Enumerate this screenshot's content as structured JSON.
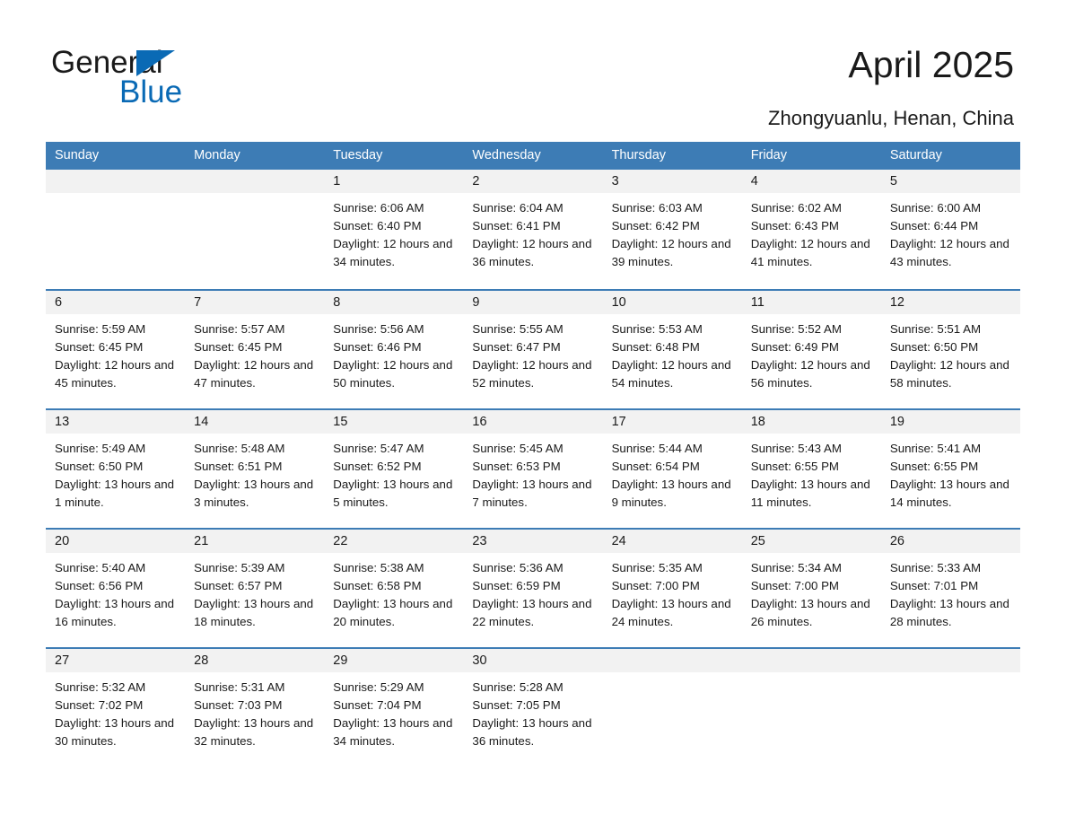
{
  "brand": {
    "name_part1": "General",
    "name_part2": "Blue",
    "triangle_color": "#0a6ab5"
  },
  "header": {
    "title": "April 2025",
    "subtitle": "Zhongyuanlu, Henan, China"
  },
  "theme": {
    "header_blue": "#3d7cb5",
    "day_band_gray": "#f2f2f2",
    "text": "#1a1a1a"
  },
  "calendar": {
    "weekdays": [
      "Sunday",
      "Monday",
      "Tuesday",
      "Wednesday",
      "Thursday",
      "Friday",
      "Saturday"
    ],
    "weeks": [
      [
        {
          "day": "",
          "sunrise": "",
          "sunset": "",
          "daylight": ""
        },
        {
          "day": "",
          "sunrise": "",
          "sunset": "",
          "daylight": ""
        },
        {
          "day": "1",
          "sunrise": "Sunrise: 6:06 AM",
          "sunset": "Sunset: 6:40 PM",
          "daylight": "Daylight: 12 hours and 34 minutes."
        },
        {
          "day": "2",
          "sunrise": "Sunrise: 6:04 AM",
          "sunset": "Sunset: 6:41 PM",
          "daylight": "Daylight: 12 hours and 36 minutes."
        },
        {
          "day": "3",
          "sunrise": "Sunrise: 6:03 AM",
          "sunset": "Sunset: 6:42 PM",
          "daylight": "Daylight: 12 hours and 39 minutes."
        },
        {
          "day": "4",
          "sunrise": "Sunrise: 6:02 AM",
          "sunset": "Sunset: 6:43 PM",
          "daylight": "Daylight: 12 hours and 41 minutes."
        },
        {
          "day": "5",
          "sunrise": "Sunrise: 6:00 AM",
          "sunset": "Sunset: 6:44 PM",
          "daylight": "Daylight: 12 hours and 43 minutes."
        }
      ],
      [
        {
          "day": "6",
          "sunrise": "Sunrise: 5:59 AM",
          "sunset": "Sunset: 6:45 PM",
          "daylight": "Daylight: 12 hours and 45 minutes."
        },
        {
          "day": "7",
          "sunrise": "Sunrise: 5:57 AM",
          "sunset": "Sunset: 6:45 PM",
          "daylight": "Daylight: 12 hours and 47 minutes."
        },
        {
          "day": "8",
          "sunrise": "Sunrise: 5:56 AM",
          "sunset": "Sunset: 6:46 PM",
          "daylight": "Daylight: 12 hours and 50 minutes."
        },
        {
          "day": "9",
          "sunrise": "Sunrise: 5:55 AM",
          "sunset": "Sunset: 6:47 PM",
          "daylight": "Daylight: 12 hours and 52 minutes."
        },
        {
          "day": "10",
          "sunrise": "Sunrise: 5:53 AM",
          "sunset": "Sunset: 6:48 PM",
          "daylight": "Daylight: 12 hours and 54 minutes."
        },
        {
          "day": "11",
          "sunrise": "Sunrise: 5:52 AM",
          "sunset": "Sunset: 6:49 PM",
          "daylight": "Daylight: 12 hours and 56 minutes."
        },
        {
          "day": "12",
          "sunrise": "Sunrise: 5:51 AM",
          "sunset": "Sunset: 6:50 PM",
          "daylight": "Daylight: 12 hours and 58 minutes."
        }
      ],
      [
        {
          "day": "13",
          "sunrise": "Sunrise: 5:49 AM",
          "sunset": "Sunset: 6:50 PM",
          "daylight": "Daylight: 13 hours and 1 minute."
        },
        {
          "day": "14",
          "sunrise": "Sunrise: 5:48 AM",
          "sunset": "Sunset: 6:51 PM",
          "daylight": "Daylight: 13 hours and 3 minutes."
        },
        {
          "day": "15",
          "sunrise": "Sunrise: 5:47 AM",
          "sunset": "Sunset: 6:52 PM",
          "daylight": "Daylight: 13 hours and 5 minutes."
        },
        {
          "day": "16",
          "sunrise": "Sunrise: 5:45 AM",
          "sunset": "Sunset: 6:53 PM",
          "daylight": "Daylight: 13 hours and 7 minutes."
        },
        {
          "day": "17",
          "sunrise": "Sunrise: 5:44 AM",
          "sunset": "Sunset: 6:54 PM",
          "daylight": "Daylight: 13 hours and 9 minutes."
        },
        {
          "day": "18",
          "sunrise": "Sunrise: 5:43 AM",
          "sunset": "Sunset: 6:55 PM",
          "daylight": "Daylight: 13 hours and 11 minutes."
        },
        {
          "day": "19",
          "sunrise": "Sunrise: 5:41 AM",
          "sunset": "Sunset: 6:55 PM",
          "daylight": "Daylight: 13 hours and 14 minutes."
        }
      ],
      [
        {
          "day": "20",
          "sunrise": "Sunrise: 5:40 AM",
          "sunset": "Sunset: 6:56 PM",
          "daylight": "Daylight: 13 hours and 16 minutes."
        },
        {
          "day": "21",
          "sunrise": "Sunrise: 5:39 AM",
          "sunset": "Sunset: 6:57 PM",
          "daylight": "Daylight: 13 hours and 18 minutes."
        },
        {
          "day": "22",
          "sunrise": "Sunrise: 5:38 AM",
          "sunset": "Sunset: 6:58 PM",
          "daylight": "Daylight: 13 hours and 20 minutes."
        },
        {
          "day": "23",
          "sunrise": "Sunrise: 5:36 AM",
          "sunset": "Sunset: 6:59 PM",
          "daylight": "Daylight: 13 hours and 22 minutes."
        },
        {
          "day": "24",
          "sunrise": "Sunrise: 5:35 AM",
          "sunset": "Sunset: 7:00 PM",
          "daylight": "Daylight: 13 hours and 24 minutes."
        },
        {
          "day": "25",
          "sunrise": "Sunrise: 5:34 AM",
          "sunset": "Sunset: 7:00 PM",
          "daylight": "Daylight: 13 hours and 26 minutes."
        },
        {
          "day": "26",
          "sunrise": "Sunrise: 5:33 AM",
          "sunset": "Sunset: 7:01 PM",
          "daylight": "Daylight: 13 hours and 28 minutes."
        }
      ],
      [
        {
          "day": "27",
          "sunrise": "Sunrise: 5:32 AM",
          "sunset": "Sunset: 7:02 PM",
          "daylight": "Daylight: 13 hours and 30 minutes."
        },
        {
          "day": "28",
          "sunrise": "Sunrise: 5:31 AM",
          "sunset": "Sunset: 7:03 PM",
          "daylight": "Daylight: 13 hours and 32 minutes."
        },
        {
          "day": "29",
          "sunrise": "Sunrise: 5:29 AM",
          "sunset": "Sunset: 7:04 PM",
          "daylight": "Daylight: 13 hours and 34 minutes."
        },
        {
          "day": "30",
          "sunrise": "Sunrise: 5:28 AM",
          "sunset": "Sunset: 7:05 PM",
          "daylight": "Daylight: 13 hours and 36 minutes."
        },
        {
          "day": "",
          "sunrise": "",
          "sunset": "",
          "daylight": ""
        },
        {
          "day": "",
          "sunrise": "",
          "sunset": "",
          "daylight": ""
        },
        {
          "day": "",
          "sunrise": "",
          "sunset": "",
          "daylight": ""
        }
      ]
    ]
  }
}
